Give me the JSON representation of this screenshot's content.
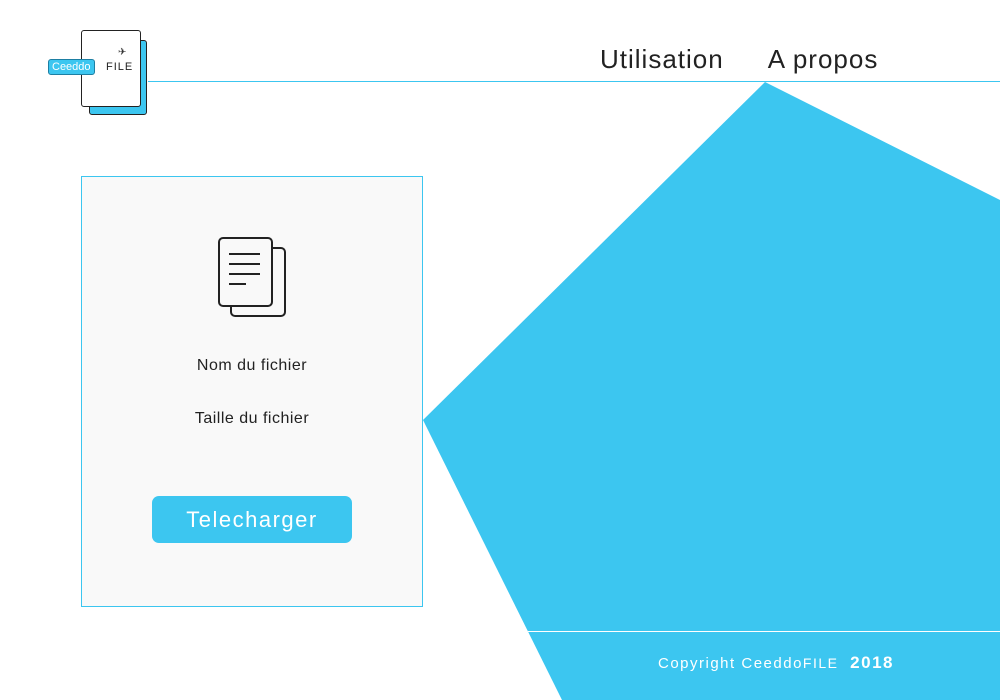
{
  "colors": {
    "accent": "#3cc6f0",
    "text": "#222222",
    "card_bg": "#f9f9f9"
  },
  "logo": {
    "brand": "Ceeddo",
    "suffix": "FILE"
  },
  "nav": {
    "items": [
      {
        "label": "Utilisation"
      },
      {
        "label": "A propos"
      }
    ]
  },
  "file_card": {
    "icon": "document-copy-icon",
    "name_label": "Nom du fichier",
    "size_label": "Taille du fichier",
    "download_label": "Telecharger"
  },
  "footer": {
    "copyright": "Copyright",
    "brand": "Ceeddo",
    "brand_suffix": "FILE",
    "year": "2018"
  }
}
